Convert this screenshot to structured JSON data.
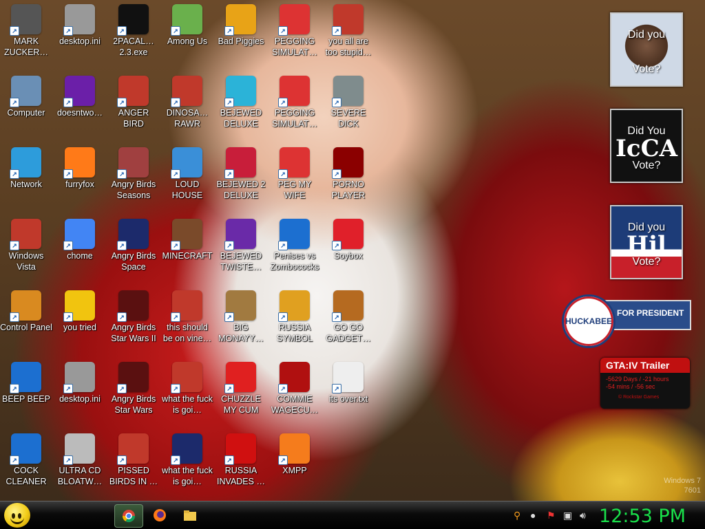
{
  "desktop": {
    "icons": [
      {
        "label": "MARK ZUCKER…",
        "icon": "mark-zuckerberg-icon"
      },
      {
        "label": "desktop.ini",
        "icon": "ini-file-icon"
      },
      {
        "label": "2PACAL… 2.3.exe",
        "icon": "console-exe-icon"
      },
      {
        "label": "Among Us",
        "icon": "among-us-icon"
      },
      {
        "label": "Bad Piggies",
        "icon": "bad-piggies-icon"
      },
      {
        "label": "PEGGING SIMULAT…",
        "icon": "p-logo-icon"
      },
      {
        "label": "you all are too stupid…",
        "icon": "dev-cpp-icon"
      },
      {
        "label": "Computer",
        "icon": "computer-icon"
      },
      {
        "label": "doesntwo…",
        "icon": "yahoo-messenger-icon"
      },
      {
        "label": "ANGER BIRD",
        "icon": "angry-birds-icon"
      },
      {
        "label": "DINOSA… RAWR",
        "icon": "angry-birds-icon"
      },
      {
        "label": "BEJEWED DELUXE",
        "icon": "bejeweled-icon"
      },
      {
        "label": "PEGGING SIMULAT…",
        "icon": "p-logo-icon"
      },
      {
        "label": "SEVERE DICK",
        "icon": "sd-gear-icon"
      },
      {
        "label": "Network",
        "icon": "network-globe-icon"
      },
      {
        "label": "furryfox",
        "icon": "firefox-icon"
      },
      {
        "label": "Angry Birds Seasons",
        "icon": "angry-birds-seasons-icon"
      },
      {
        "label": "LOUD HOUSE",
        "icon": "loud-house-icon"
      },
      {
        "label": "BEJEWED 2 DELUXE",
        "icon": "bejeweled-2-icon"
      },
      {
        "label": "PEG MY WIFE",
        "icon": "p-logo-icon"
      },
      {
        "label": "PORNO PLAYER",
        "icon": "flash-player-icon"
      },
      {
        "label": "Windows Vista",
        "icon": "recycle-bin-icon"
      },
      {
        "label": "chome",
        "icon": "chrome-icon"
      },
      {
        "label": "Angry Birds Space",
        "icon": "angry-birds-space-icon"
      },
      {
        "label": "MINECRAFT",
        "icon": "minecraft-icon"
      },
      {
        "label": "BEJEWED TWISTE…",
        "icon": "bejeweled-twist-icon"
      },
      {
        "label": "Penises vs Zombococks",
        "icon": "blue-book-icon"
      },
      {
        "label": "Soybox",
        "icon": "soybox-icon"
      },
      {
        "label": "Control Panel",
        "icon": "control-panel-icon"
      },
      {
        "label": "you tried",
        "icon": "gold-star-icon"
      },
      {
        "label": "Angry Birds Star Wars II",
        "icon": "angry-birds-star-wars-icon"
      },
      {
        "label": "this should be on vine…",
        "icon": "angry-birds-icon"
      },
      {
        "label": "BIG MONAYY…",
        "icon": "money-bag-icon"
      },
      {
        "label": "RUSSIA SYMBOL",
        "icon": "russia-symbol-icon"
      },
      {
        "label": "GO GO GADGET…",
        "icon": "briefcase-icon"
      },
      {
        "label": "BEEP BEEP",
        "icon": "blue-book-icon"
      },
      {
        "label": "desktop.ini",
        "icon": "ini-file-icon"
      },
      {
        "label": "Angry Birds Star Wars",
        "icon": "angry-birds-star-wars-icon"
      },
      {
        "label": "what the fuck is goi…",
        "icon": "angry-birds-icon"
      },
      {
        "label": "CHUZZLE MY CUM",
        "icon": "chuzzle-icon"
      },
      {
        "label": "COMMIE WAGECU…",
        "icon": "commie-flag-icon"
      },
      {
        "label": "its over.txt",
        "icon": "text-file-icon"
      },
      {
        "label": "COCK CLEANER",
        "icon": "blue-book-icon"
      },
      {
        "label": "ULTRA CD BLOATW…",
        "icon": "cd-burner-icon"
      },
      {
        "label": "PISSED BIRDS IN …",
        "icon": "angry-birds-icon"
      },
      {
        "label": "what the fuck is goi…",
        "icon": "angry-birds-space-icon"
      },
      {
        "label": "RUSSIA INVADES …",
        "icon": "radiation-icon"
      },
      {
        "label": "XMPP",
        "icon": "xampp-icon"
      }
    ]
  },
  "gadgets": {
    "vote1": {
      "top": "Did you",
      "bottom": "Vote?",
      "big": ""
    },
    "vote2": {
      "top": "Did You",
      "bottom": "Vote?",
      "big": "IcCA"
    },
    "vote3": {
      "top": "Did you",
      "bottom": "Vote?",
      "big": "Hil"
    },
    "huckabee": {
      "seal": "HUCKABEE",
      "text": "FOR PRESIDENT"
    },
    "gta": {
      "title": "GTA:IV Trailer",
      "line1": "-5629 Days / -21 hours",
      "line2": "-54 mins / -56 sec",
      "footer": "© Rockstar Games"
    }
  },
  "watermark": {
    "line1": "Windows 7",
    "line2": "7601"
  },
  "taskbar": {
    "clock": "12:53 PM",
    "buttons": [
      "chrome-icon",
      "firefox-icon",
      "folder-icon"
    ],
    "tray": [
      "search-icon",
      "messenger-icon",
      "flag-icon",
      "network-icon",
      "volume-icon"
    ]
  },
  "colors": {
    "clock": "#19e04a",
    "taskbar": "#000000",
    "gta_red": "#c01010"
  }
}
